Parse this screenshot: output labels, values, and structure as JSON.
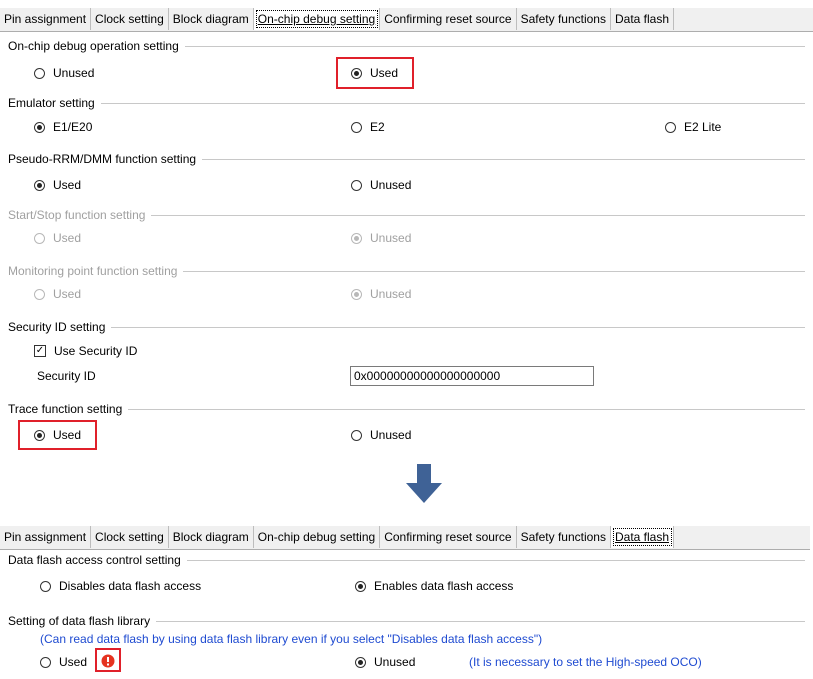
{
  "panel1": {
    "tabs": [
      "Pin assignment",
      "Clock setting",
      "Block diagram",
      "On-chip debug setting",
      "Confirming reset source",
      "Safety functions",
      "Data flash"
    ],
    "active_tab": "On-chip debug setting",
    "ocd": {
      "title": "On-chip debug operation setting",
      "unused": "Unused",
      "used": "Used",
      "selected": "Used"
    },
    "emulator": {
      "title": "Emulator setting",
      "e1e20": "E1/E20",
      "e2": "E2",
      "e2lite": "E2 Lite",
      "selected": "E1/E20"
    },
    "pseudo": {
      "title": "Pseudo-RRM/DMM function setting",
      "used": "Used",
      "unused": "Unused",
      "selected": "Used"
    },
    "startstop": {
      "title": "Start/Stop function setting",
      "used": "Used",
      "unused": "Unused",
      "selected": "Unused",
      "disabled": true
    },
    "monitor": {
      "title": "Monitoring point function setting",
      "used": "Used",
      "unused": "Unused",
      "selected": "Unused",
      "disabled": true
    },
    "security": {
      "title": "Security ID setting",
      "checkbox_label": "Use Security ID",
      "checked": true,
      "field_label": "Security ID",
      "value": "0x00000000000000000000"
    },
    "trace": {
      "title": "Trace function setting",
      "used": "Used",
      "unused": "Unused",
      "selected": "Used"
    }
  },
  "panel2": {
    "tabs": [
      "Pin assignment",
      "Clock setting",
      "Block diagram",
      "On-chip debug setting",
      "Confirming reset source",
      "Safety functions",
      "Data flash"
    ],
    "active_tab": "Data flash",
    "access": {
      "title": "Data flash access control setting",
      "disables": "Disables data flash access",
      "enables": "Enables data flash access",
      "selected": "Enables data flash access"
    },
    "library": {
      "title": "Setting of data flash library",
      "note": "(Can read data flash by using data flash library even if you select \"Disables data flash access\")",
      "used": "Used",
      "unused": "Unused",
      "unused_note": "(It is necessary to set the High-speed OCO)",
      "selected": "Unused"
    }
  },
  "colors": {
    "highlight": "#e0202a",
    "arrow": "#3f6296",
    "note": "#1f4bd1",
    "warning": "#e53320"
  }
}
